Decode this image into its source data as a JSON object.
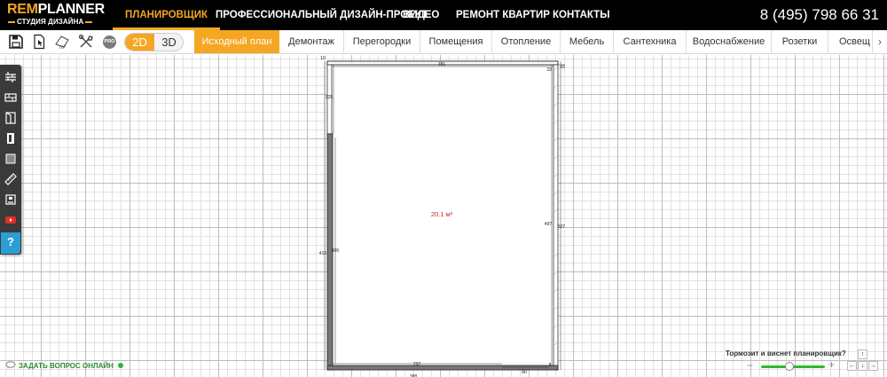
{
  "logo": {
    "line1_a": "REM",
    "line1_b": "PLANNER",
    "line2": "СТУДИЯ ДИЗАЙНА"
  },
  "nav": [
    {
      "label": "ПЛАНИРОВЩИК",
      "active": true
    },
    {
      "label": "ПРОФЕССИОНАЛЬНЫЙ ДИЗАЙН-ПРОЕКТ",
      "active": false
    },
    {
      "label": "ВИДЕО",
      "active": false
    },
    {
      "label": "РЕМОНТ КВАРТИР",
      "active": false
    },
    {
      "label": "КОНТАКТЫ",
      "active": false
    }
  ],
  "phone": "8 (495) 798 66 31",
  "toolbar": {
    "icons": [
      "save-icon",
      "import-icon",
      "area-m2-icon",
      "tools-icon",
      "pro-icon"
    ],
    "pro_label": "PRO",
    "view_2d": "2D",
    "view_3d": "3D",
    "view_selected": "2D"
  },
  "tabs": [
    {
      "label": "Исходный план",
      "active": true
    },
    {
      "label": "Демонтаж",
      "active": false
    },
    {
      "label": "Перегородки",
      "active": false
    },
    {
      "label": "Помещения",
      "active": false
    },
    {
      "label": "Отопление",
      "active": false
    },
    {
      "label": "Мебель",
      "active": false
    },
    {
      "label": "Сантехника",
      "active": false
    },
    {
      "label": "Водоснабжение",
      "active": false
    },
    {
      "label": "Розетки",
      "active": false
    },
    {
      "label": "Освещ",
      "active": false
    }
  ],
  "tab_scroll": "›",
  "leftbar": {
    "items": [
      "walls-tool-icon",
      "brick-wall-icon",
      "door-icon",
      "door-open-icon",
      "floor-tile-icon",
      "ruler-icon",
      "furniture-icon",
      "youtube-icon",
      "help-icon"
    ],
    "help_label": "?"
  },
  "plan": {
    "area": "20.1 м²",
    "dims": {
      "top_inner": "381",
      "top_left": "10",
      "top_right": "33",
      "top_right_outer": "43",
      "left_upper": "125",
      "left_inner": "405",
      "left_outer": "415",
      "right_inner": "497",
      "right_outer": "507",
      "bottom_inner": "292",
      "bottom_right": "80",
      "bottom_right_small": "8",
      "bottom_outer": "388"
    }
  },
  "chat": {
    "label": "ЗАДАТЬ ВОПРОС ОНЛАЙН"
  },
  "zoom": {
    "slow_label": "Тормозит и виснет планировщик?",
    "minus": "−",
    "plus": "+",
    "level": 0.45
  },
  "pan": {
    "up": "↑",
    "left": "←",
    "down": "↓",
    "right": "→"
  }
}
